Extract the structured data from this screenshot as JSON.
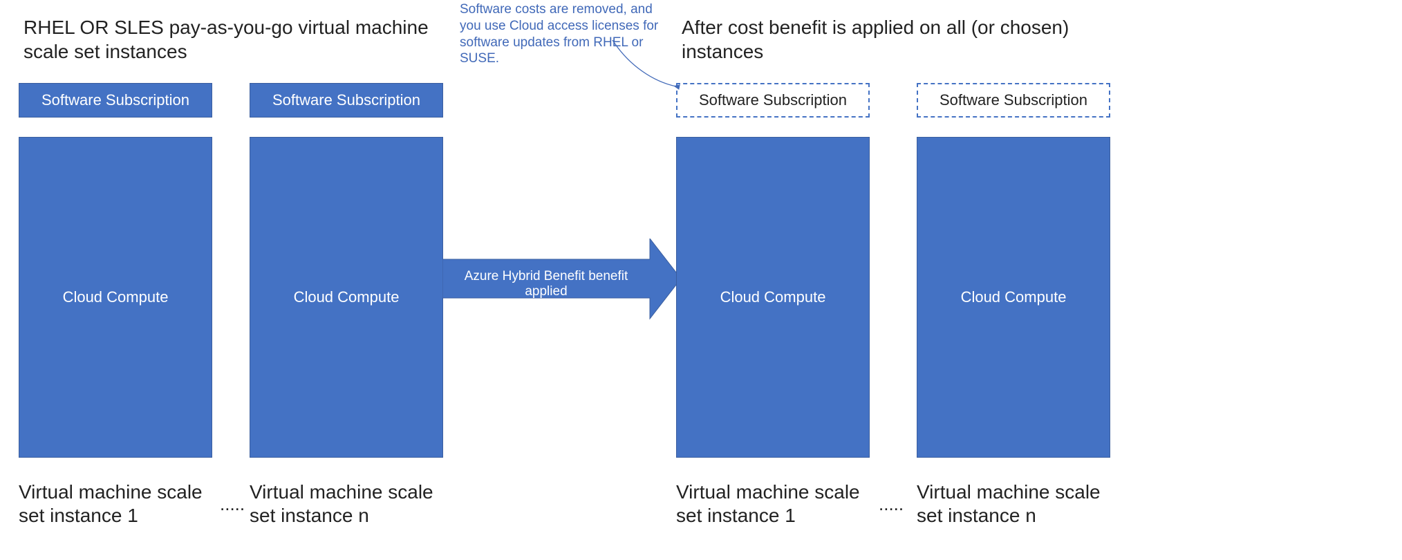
{
  "headings": {
    "left": "RHEL OR SLES pay-as-you-go virtual machine scale set instances",
    "right": "After cost benefit is applied on all (or chosen) instances"
  },
  "annotation": "Software costs are removed, and you use Cloud access licenses for software updates from RHEL or SUSE.",
  "labels": {
    "software_subscription": "Software Subscription",
    "cloud_compute": "Cloud Compute",
    "arrow": "Azure Hybrid Benefit benefit applied"
  },
  "captions": {
    "instance_1": "Virtual machine scale set instance 1",
    "instance_n": "Virtual machine scale set instance n",
    "ellipsis": "....."
  },
  "colors": {
    "primary": "#4472c4",
    "annotation": "#4169b8"
  }
}
